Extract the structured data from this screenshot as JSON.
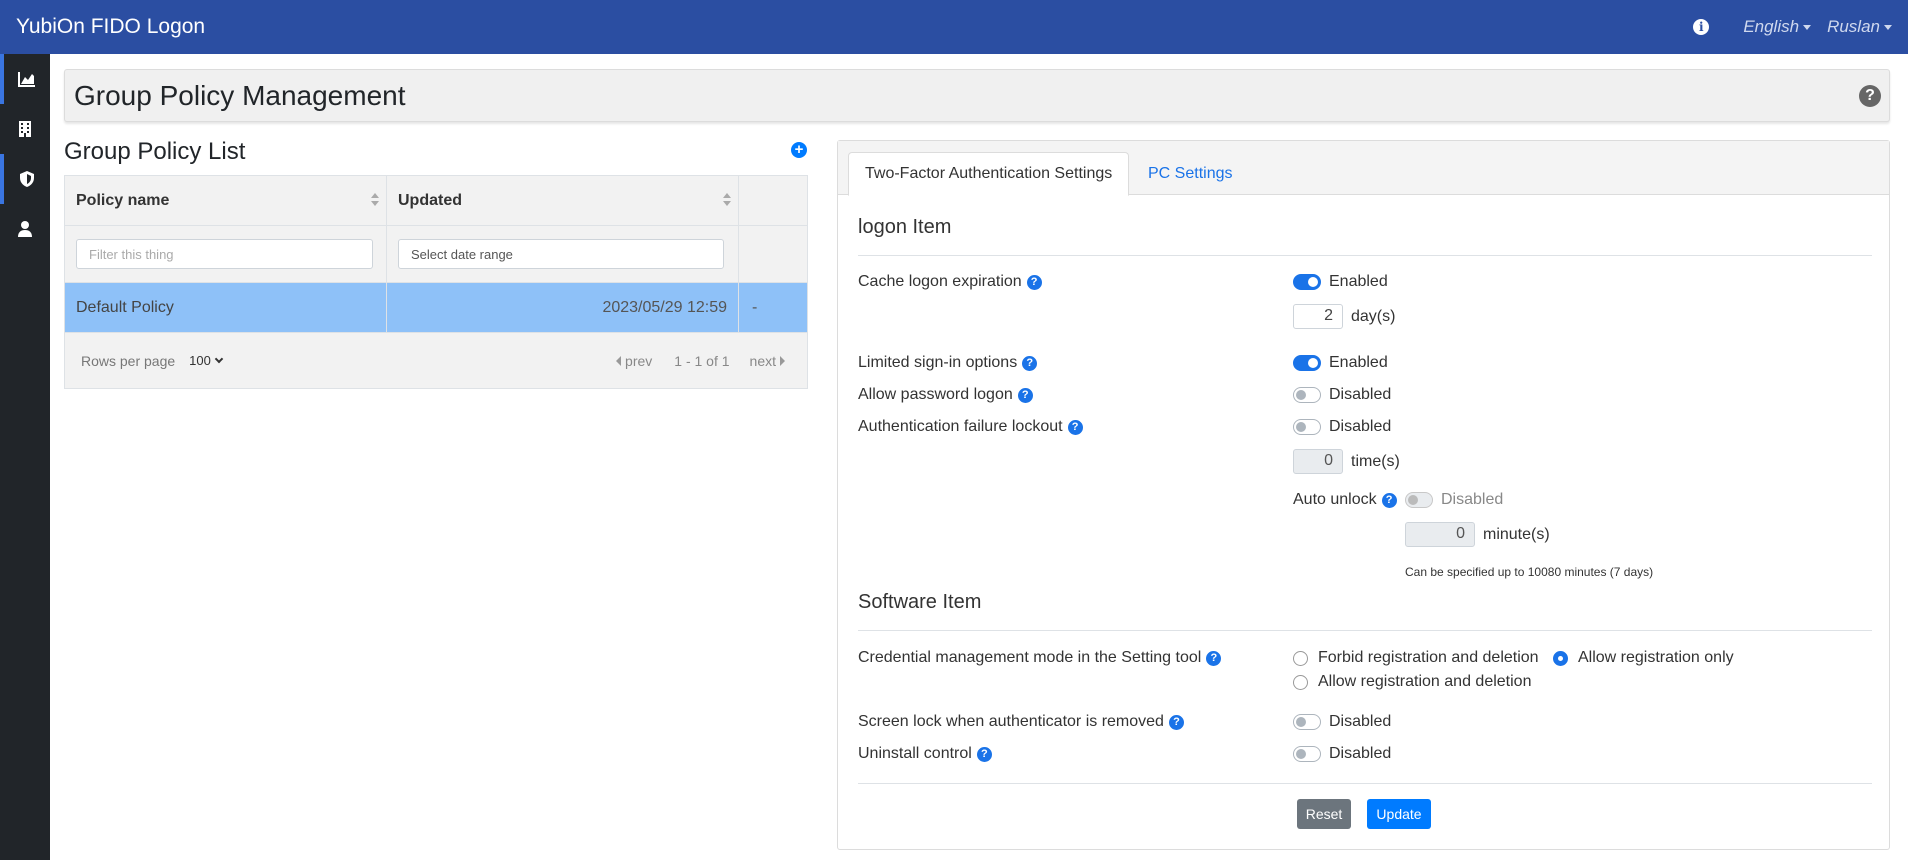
{
  "navbar": {
    "brand": "YubiOn FIDO Logon",
    "language": "English",
    "user": "Ruslan"
  },
  "sidebar": {
    "items": [
      {
        "icon": "chart-area-icon"
      },
      {
        "icon": "building-icon"
      },
      {
        "icon": "shield-icon"
      },
      {
        "icon": "user-icon"
      }
    ]
  },
  "page": {
    "title": "Group Policy Management"
  },
  "policy_list": {
    "title": "Group Policy List",
    "columns": [
      "Policy name",
      "Updated"
    ],
    "filter_placeholder": "Filter this thing",
    "date_placeholder": "Select date range",
    "rows": [
      {
        "name": "Default Policy",
        "updated": "2023/05/29 12:59",
        "extra": "-"
      }
    ],
    "pager": {
      "rows_per_page_label": "Rows per page",
      "rows_per_page_value": "100",
      "prev": "prev",
      "range": "1 - 1 of 1",
      "next": "next"
    }
  },
  "tabs": [
    {
      "label": "Two-Factor Authentication Settings",
      "active": true
    },
    {
      "label": "PC Settings",
      "active": false
    }
  ],
  "logon": {
    "section_title": "logon Item",
    "cache_logon": {
      "label": "Cache logon expiration",
      "status": "Enabled",
      "value": "2",
      "unit": "day(s)"
    },
    "limited_signin": {
      "label": "Limited sign-in options",
      "status": "Enabled"
    },
    "allow_password": {
      "label": "Allow password logon",
      "status": "Disabled"
    },
    "auth_lockout": {
      "label": "Authentication failure lockout",
      "status": "Disabled",
      "value": "0",
      "unit": "time(s)"
    },
    "auto_unlock": {
      "label": "Auto unlock",
      "status": "Disabled",
      "value": "0",
      "unit": "minute(s)",
      "hint": "Can be specified up to 10080 minutes (7 days)"
    }
  },
  "software": {
    "section_title": "Software Item",
    "credential_mode": {
      "label": "Credential management mode in the Setting tool",
      "options": [
        "Forbid registration and deletion",
        "Allow registration only",
        "Allow registration and deletion"
      ],
      "selected": "Allow registration only"
    },
    "screen_lock": {
      "label": "Screen lock when authenticator is removed",
      "status": "Disabled"
    },
    "uninstall": {
      "label": "Uninstall control",
      "status": "Disabled"
    }
  },
  "buttons": {
    "reset": "Reset",
    "update": "Update"
  },
  "colors": {
    "navbar": "#2b4ea2",
    "sidebar": "#212529",
    "accent": "#1a73e8",
    "selected_row": "#8ec1f8"
  }
}
